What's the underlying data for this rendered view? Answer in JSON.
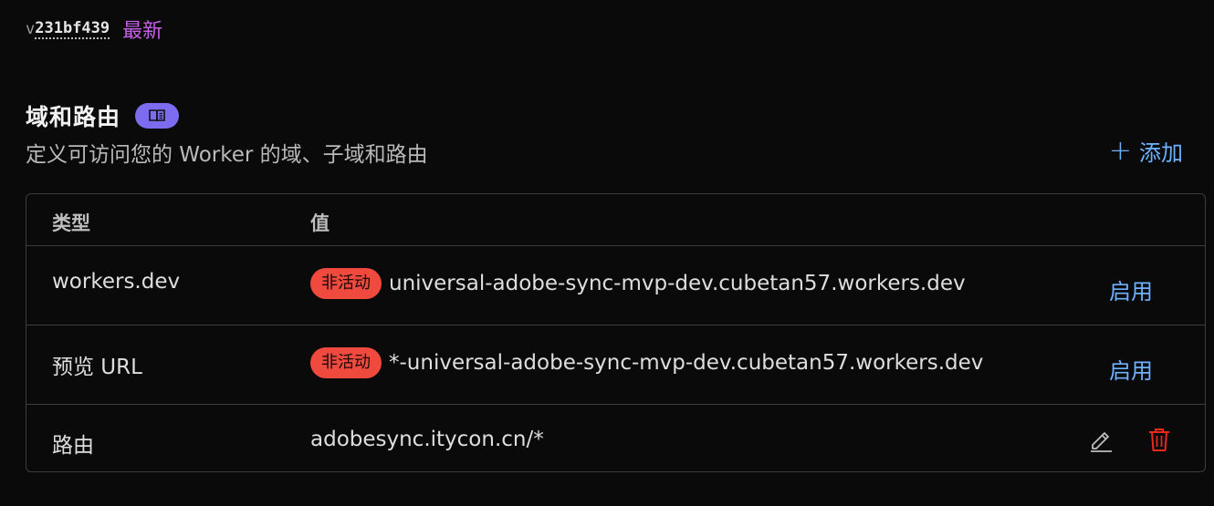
{
  "version": {
    "prefix": "v",
    "id": "231bf439",
    "latest_label": "最新"
  },
  "section": {
    "title": "域和路由",
    "docs_icon": "book-icon",
    "description": "定义可访问您的 Worker 的域、子域和路由",
    "add_label": "添加"
  },
  "table": {
    "headers": {
      "type": "类型",
      "value": "值"
    },
    "rows": [
      {
        "type": "workers.dev",
        "status": "非活动",
        "value": "universal-adobe-sync-mvp-dev.cubetan57.workers.dev",
        "action": "启用"
      },
      {
        "type": "预览 URL",
        "status": "非活动",
        "value": "*-universal-adobe-sync-mvp-dev.cubetan57.workers.dev",
        "action": "启用"
      },
      {
        "type": "路由",
        "value": "adobesync.itycon.cn/*",
        "edit_icon": "pencil-icon",
        "delete_icon": "trash-icon"
      }
    ]
  },
  "colors": {
    "background": "#0a0a0a",
    "accent_link": "#6fb1ff",
    "latest_purple": "#c760e8",
    "docs_pill": "#7b6cf0",
    "inactive_badge": "#f04a3e",
    "delete_red": "#e8291c"
  }
}
